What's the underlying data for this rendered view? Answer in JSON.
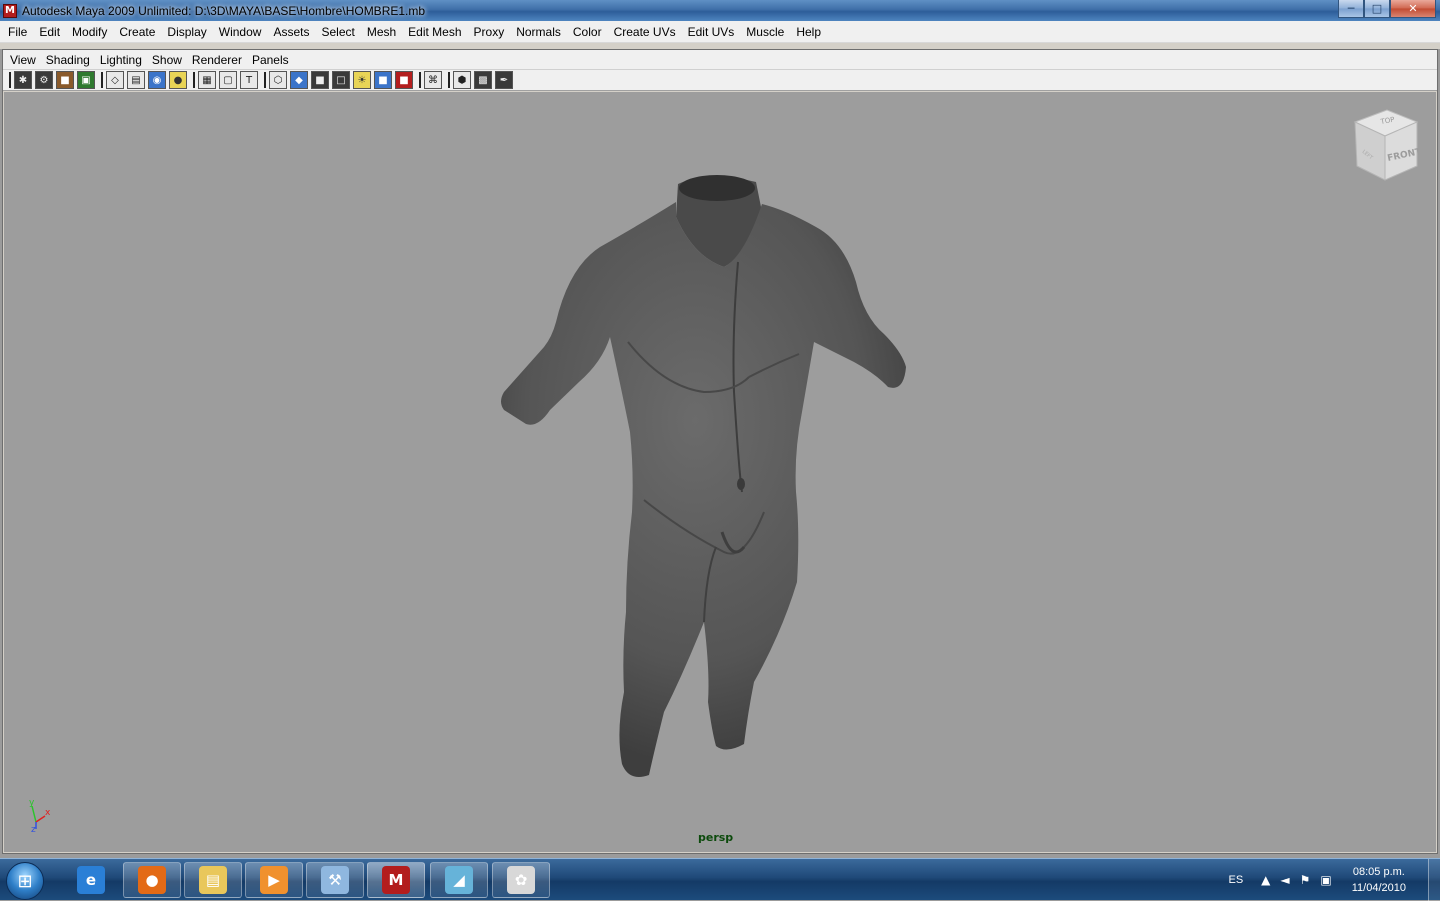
{
  "window": {
    "title": "Autodesk Maya 2009 Unlimited: D:\\3D\\MAYA\\BASE\\Hombre\\HOMBRE1.mb",
    "icon_label": "M",
    "minimize_glyph": "─",
    "maximize_glyph": "□",
    "close_glyph": "✕"
  },
  "main_menu": [
    "File",
    "Edit",
    "Modify",
    "Create",
    "Display",
    "Window",
    "Assets",
    "Select",
    "Mesh",
    "Edit Mesh",
    "Proxy",
    "Normals",
    "Color",
    "Create UVs",
    "Edit UVs",
    "Muscle",
    "Help"
  ],
  "panel_menu": [
    "View",
    "Shading",
    "Lighting",
    "Show",
    "Renderer",
    "Panels"
  ],
  "toolbar_icons": [
    {
      "name": "select-camera-icon",
      "glyph": "✱",
      "style": "dark"
    },
    {
      "name": "camera-attributes-icon",
      "glyph": "⚙",
      "style": "dark"
    },
    {
      "name": "bookmarks-icon",
      "glyph": "■",
      "style": "brown"
    },
    {
      "name": "image-plane-icon",
      "glyph": "▣",
      "style": "green"
    },
    {
      "sep": true
    },
    {
      "name": "grid-icon",
      "glyph": "◇",
      "style": ""
    },
    {
      "name": "film-gate-icon",
      "glyph": "▤",
      "style": ""
    },
    {
      "name": "resolution-gate-icon",
      "glyph": "◉",
      "style": "blue"
    },
    {
      "name": "gate-mask-icon",
      "glyph": "●",
      "style": "yellow"
    },
    {
      "sep": true
    },
    {
      "name": "field-chart-icon",
      "glyph": "▦",
      "style": ""
    },
    {
      "name": "safe-action-icon",
      "glyph": "▢",
      "style": ""
    },
    {
      "name": "safe-title-icon",
      "glyph": "T",
      "style": ""
    },
    {
      "sep": true
    },
    {
      "name": "wireframe-icon",
      "glyph": "⬡",
      "style": ""
    },
    {
      "name": "smooth-shade-icon",
      "glyph": "◆",
      "style": "blue"
    },
    {
      "name": "flat-shade-icon",
      "glyph": "■",
      "style": "dark"
    },
    {
      "name": "bounding-box-icon",
      "glyph": "□",
      "style": "dark"
    },
    {
      "name": "use-lights-icon",
      "glyph": "☀",
      "style": "yellow"
    },
    {
      "name": "textured-icon",
      "glyph": "■",
      "style": "blue"
    },
    {
      "name": "shadows-icon",
      "glyph": "■",
      "style": "red"
    },
    {
      "sep": true
    },
    {
      "name": "isolate-select-icon",
      "glyph": "⌘",
      "style": ""
    },
    {
      "sep": true
    },
    {
      "name": "xray-icon",
      "glyph": "⬢",
      "style": ""
    },
    {
      "name": "xray-joints-icon",
      "glyph": "▩",
      "style": "dark"
    },
    {
      "name": "hardware-render-icon",
      "glyph": "✒",
      "style": "dark"
    }
  ],
  "viewport": {
    "camera_label": "persp",
    "viewcube_top": "TOP",
    "viewcube_front": "FRONT",
    "viewcube_left": "LEFT",
    "axis_x": "x",
    "axis_y": "y",
    "axis_z": "z",
    "model_color": "#595959",
    "background_color": "#9d9d9d"
  },
  "taskbar": {
    "start_glyph": "⊞",
    "buttons": [
      {
        "name": "internet-explorer-icon",
        "glyph": "e",
        "color": "#2a7fd6",
        "style": "plain"
      },
      {
        "name": "firefox-icon",
        "glyph": "●",
        "color": "#e36a16",
        "style": ""
      },
      {
        "name": "file-explorer-icon",
        "glyph": "▤",
        "color": "#e9c75b",
        "style": ""
      },
      {
        "name": "media-player-icon",
        "glyph": "▶",
        "color": "#f0912e",
        "style": ""
      },
      {
        "name": "tools-icon",
        "glyph": "⚒",
        "color": "#8fb7df",
        "style": ""
      },
      {
        "name": "maya-icon",
        "glyph": "M",
        "color": "#b31d1d",
        "style": "active"
      },
      {
        "name": "window-manager-icon",
        "glyph": "◢",
        "color": "#66b3d9",
        "style": ""
      },
      {
        "name": "paint-icon",
        "glyph": "✿",
        "color": "#d8d8d8",
        "style": ""
      }
    ],
    "language": "ES",
    "tray_up_glyph": "▲",
    "volume_glyph": "◄",
    "network_glyph": "▣",
    "flag_glyph": "⚑",
    "time": "08:05 p.m.",
    "date": "11/04/2010"
  }
}
